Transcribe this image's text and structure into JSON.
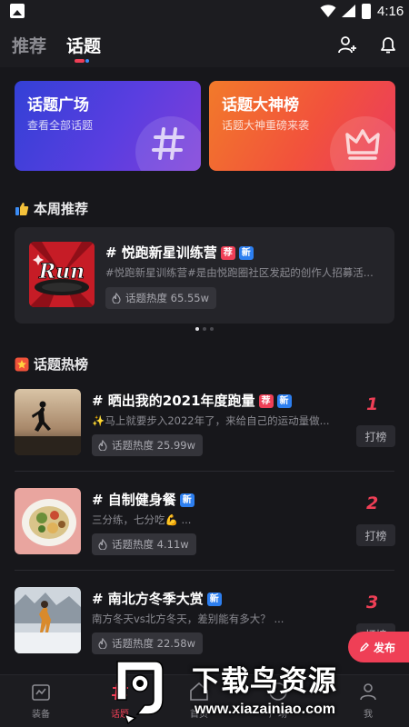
{
  "status_bar": {
    "time": "4:16"
  },
  "header": {
    "tabs": [
      {
        "label": "推荐",
        "active": false
      },
      {
        "label": "话题",
        "active": true
      }
    ]
  },
  "banners": [
    {
      "title": "话题广场",
      "subtitle": "查看全部话题",
      "icon": "hash-icon",
      "color": "#4a3fe0"
    },
    {
      "title": "话题大神榜",
      "subtitle": "话题大神重磅来袭",
      "icon": "crown-icon",
      "color": "#f0523a"
    }
  ],
  "weekly": {
    "section_title": "本周推荐",
    "icon": "thumbs-up-icon",
    "card": {
      "title": "# 悦跑新星训练营",
      "badges": [
        "荐",
        "新"
      ],
      "description": "#悦跑新星训练营#是由悦跑圈社区发起的创作人招募活...",
      "heat": "话题热度 65.55w",
      "thumb_text": "Run"
    },
    "carousel": {
      "pages": 3,
      "active": 1
    }
  },
  "hot": {
    "section_title": "话题热榜",
    "icon": "star-badge-icon",
    "items": [
      {
        "rank": "1",
        "title": "# 晒出我的2021年度跑量",
        "badges": [
          "荐",
          "新"
        ],
        "description": "✨马上就要步入2022年了，来给自己的运动量做...",
        "heat": "话题热度 25.99w",
        "button": "打榜"
      },
      {
        "rank": "2",
        "title": "# 自制健身餐",
        "badges": [
          "新"
        ],
        "description": "三分练，七分吃💪 ...",
        "heat": "话题热度 4.11w",
        "button": "打榜"
      },
      {
        "rank": "3",
        "title": "# 南北方冬季大赏",
        "badges": [
          "新"
        ],
        "description": "南方冬天vs北方冬天，差别能有多大？ ...",
        "heat": "话题热度 22.58w",
        "button": "打榜"
      }
    ]
  },
  "float_button": {
    "label": "发布"
  },
  "bottom_nav": [
    {
      "label": "装备",
      "icon": "bag-icon",
      "active": false
    },
    {
      "label": "话题",
      "icon": "topic-icon",
      "active": true
    },
    {
      "label": "首页",
      "icon": "home-icon",
      "active": false
    },
    {
      "label": "广场",
      "icon": "square-icon",
      "active": false
    },
    {
      "label": "我",
      "icon": "user-icon",
      "active": false
    }
  ],
  "watermark": {
    "text": "下载鸟资源",
    "url": "www.xiazainiao.com"
  },
  "colors": {
    "accent_red": "#ef3f56",
    "accent_blue": "#2d7ff0",
    "background": "#17171b",
    "card": "#242429"
  }
}
